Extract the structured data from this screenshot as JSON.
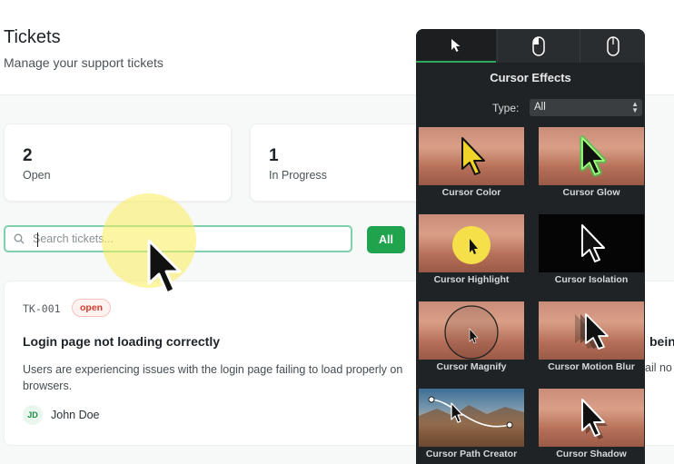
{
  "header": {
    "title": "Tickets",
    "subtitle": "Manage your support tickets"
  },
  "stats": [
    {
      "count": "2",
      "label": "Open"
    },
    {
      "count": "1",
      "label": "In Progress"
    }
  ],
  "search": {
    "placeholder": "Search tickets..."
  },
  "filter": {
    "all_label": "All"
  },
  "ticket": {
    "id": "TK-001",
    "status": "open",
    "title": "Login page not loading correctly",
    "title_overflow": "bein",
    "description": "Users are experiencing issues with the login page failing to load properly on",
    "description_line2": "browsers.",
    "description_overflow": "ail no",
    "assignee_initials": "JD",
    "assignee_name": "John Doe"
  },
  "panel": {
    "tabs": [
      {
        "icon": "pointer-icon"
      },
      {
        "icon": "mouse-icon"
      },
      {
        "icon": "mouse-icon"
      }
    ],
    "title": "Cursor Effects",
    "type_label": "Type:",
    "type_value": "All",
    "effects": [
      {
        "label": "Cursor Color"
      },
      {
        "label": "Cursor Glow"
      },
      {
        "label": "Cursor Highlight"
      },
      {
        "label": "Cursor Isolation"
      },
      {
        "label": "Cursor Magnify"
      },
      {
        "label": "Cursor Motion Blur"
      },
      {
        "label": "Cursor Path Creator"
      },
      {
        "label": "Cursor Shadow"
      }
    ],
    "colors": {
      "accent": "#2ea85a",
      "highlight_yellow": "#f5e04a",
      "glow_green": "#33d14b"
    }
  },
  "colors": {
    "primary_button": "#1fa34d",
    "badge_red": "#d23b2c",
    "search_focus": "#7fd0ad"
  }
}
